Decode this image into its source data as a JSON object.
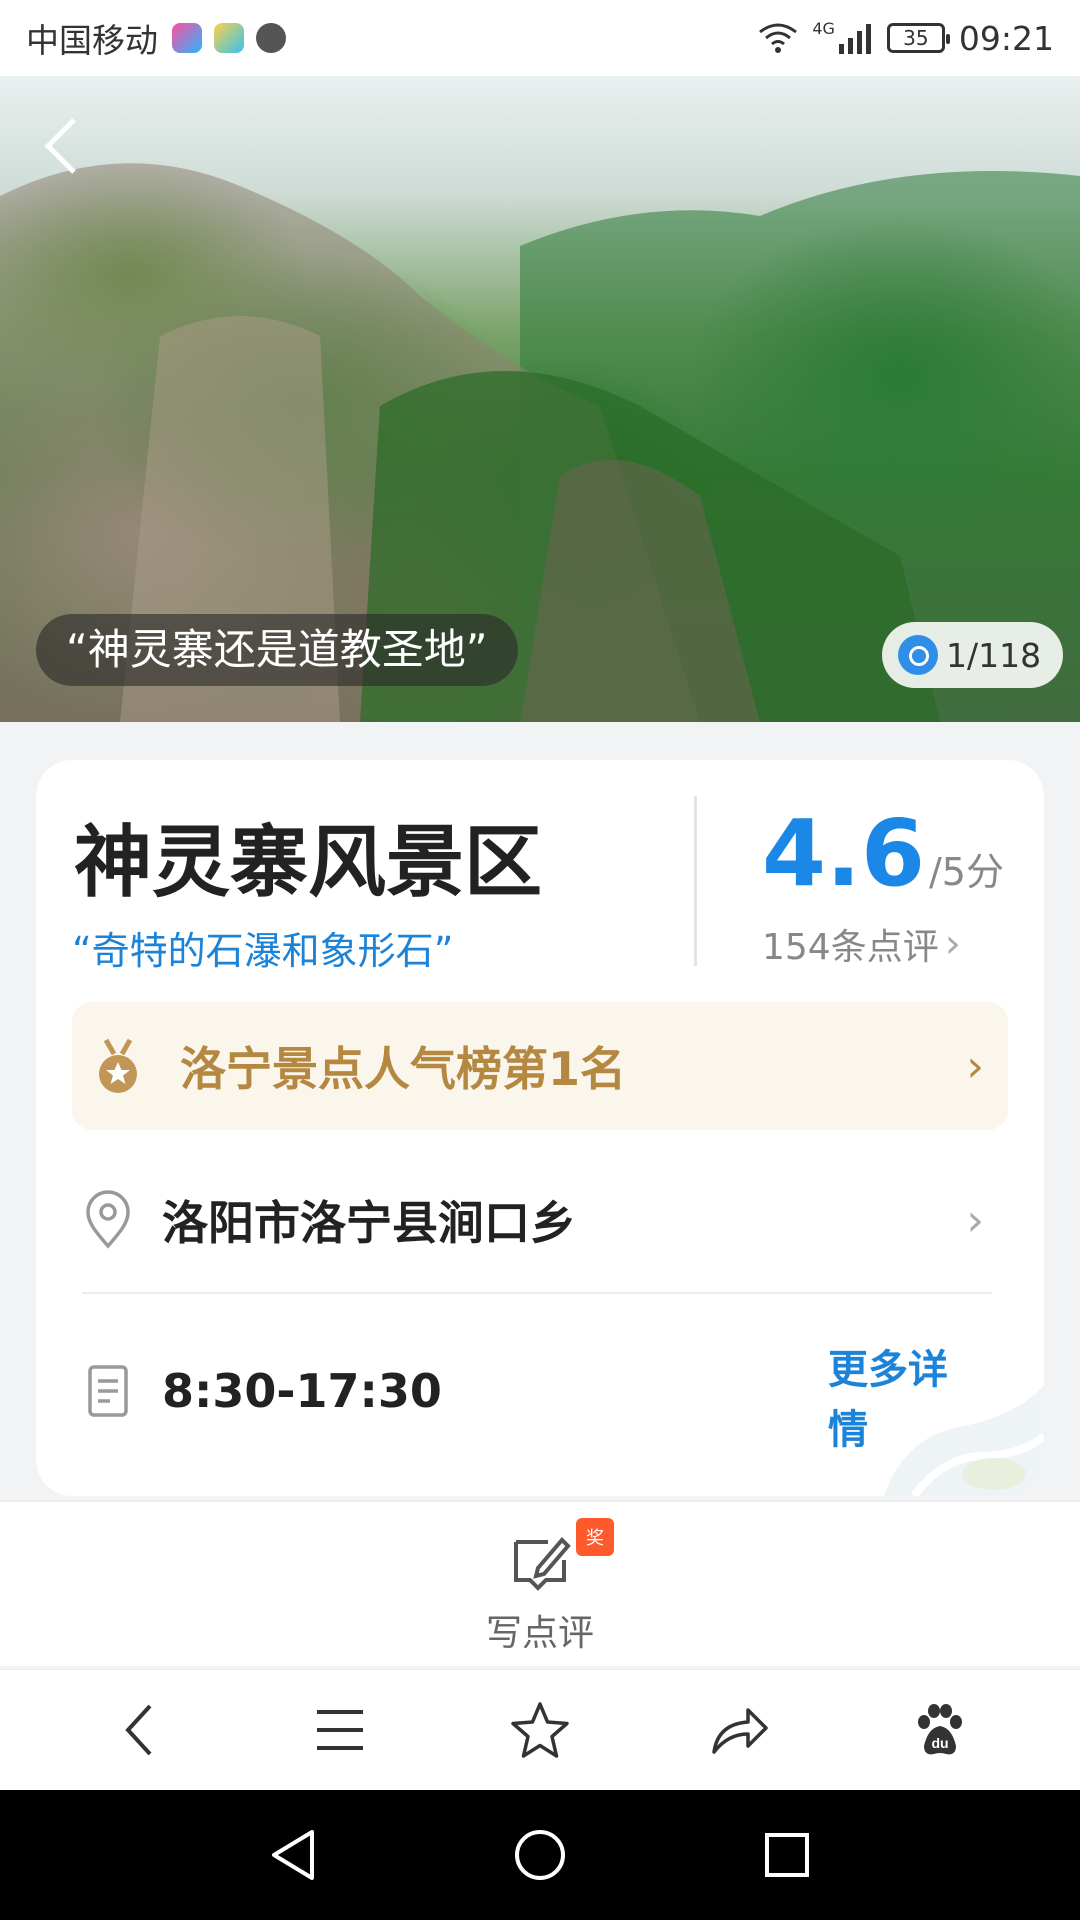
{
  "status_bar": {
    "carrier": "中国移动",
    "network": "4G",
    "battery": "35",
    "time": "09:21"
  },
  "hero": {
    "caption": "“神灵寨还是道教圣地”",
    "photo_counter": "1/118"
  },
  "card": {
    "title": "神灵寨风景区",
    "subtitle": "“奇特的石瀑和象形石”",
    "score": "4.6",
    "score_unit": "/5分",
    "reviews": "154条点评",
    "rank": "洛宁景点人气榜第1名",
    "address": "洛阳市洛宁县涧口乡",
    "hours": "8:30-17:30",
    "more_details": "更多详情"
  },
  "write_review": {
    "label": "写点评",
    "badge": "奖"
  },
  "colors": {
    "accent_blue": "#1b87e6",
    "rank_gold": "#b58842",
    "badge_red": "#ff5a2c"
  },
  "icons": {
    "toolbar": [
      "back-icon",
      "menu-icon",
      "star-icon",
      "share-icon",
      "baidu-paw-icon"
    ],
    "nav": [
      "nav-back-icon",
      "nav-home-icon",
      "nav-recents-icon"
    ]
  }
}
